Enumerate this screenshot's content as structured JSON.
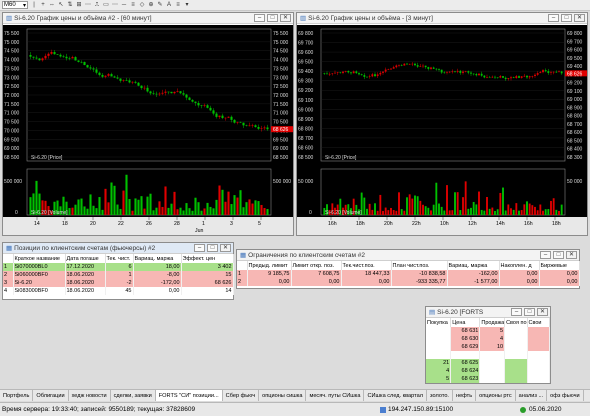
{
  "toolbar": {
    "timeframe": "M60",
    "buttons": [
      "|",
      "+",
      "⇔",
      "↖",
      "⇅",
      "⊞",
      "⋯",
      "⎍",
      "▭",
      "⋯",
      "─",
      "≡",
      "◇",
      "⊕",
      "✎",
      "A",
      "≡",
      "▾"
    ]
  },
  "chart1": {
    "title": "Si-6.20 График цены и объёма #2 - [60 минут]",
    "price_ticks": [
      "75 500",
      "75 000",
      "74 500",
      "74 000",
      "73 500",
      "73 000",
      "72 500",
      "72 000",
      "71 500",
      "71 000",
      "70 500",
      "70 000",
      "69 500",
      "69 000",
      "68 500"
    ],
    "right_ticks": [
      "75 500",
      "75 000",
      "74 500",
      "74 000",
      "73 500",
      "73 000",
      "72 500",
      "72 000",
      "71 500",
      "71 000",
      "70 500",
      "70 000",
      "69 500",
      "69 000",
      "68 500"
    ],
    "price_label": "Si-6.20 [Price]",
    "volume_label": "Si-6.20 [Volume]",
    "volume_ticks": [
      "500 000",
      "0"
    ],
    "x_labels": [
      "14",
      "18",
      "20",
      "22",
      "26",
      "28",
      "1",
      "3",
      "5"
    ],
    "x_sub": "Jun",
    "last_price": "68 626"
  },
  "chart2": {
    "title": "Si-6.20 График цены и объёма - [3 минут]",
    "price_ticks": [
      "69 800",
      "69 700",
      "69 600",
      "69 500",
      "69 400",
      "69 300",
      "69 200",
      "69 100",
      "69 000",
      "68 900",
      "68 800",
      "68 700",
      "68 600",
      "68 500"
    ],
    "right_ticks": [
      "69 800",
      "69 700",
      "69 600",
      "69 500",
      "69 400",
      "69 300",
      "69 200",
      "69 100",
      "69 000",
      "68 900",
      "68 800",
      "68 700",
      "68 600",
      "68 500",
      "68 400",
      "68 300"
    ],
    "price_label": "Si-6.20 [Price]",
    "volume_label": "Si-6.20 [Volume]",
    "volume_ticks": [
      "50 000",
      "0"
    ],
    "x_labels": [
      "16h",
      "18h",
      "20h",
      "22h",
      "10h",
      "12h",
      "14h",
      "16h",
      "18h"
    ],
    "last_price": "68 626"
  },
  "positions": {
    "title": "Позиции по клиентским счетам (фьючерсы) #2",
    "columns": [
      "",
      "Краткое название",
      "Дата погаше",
      "Тек. чист.",
      "Вариац. маржа",
      "Эффект. цен"
    ],
    "rows": [
      {
        "n": "1",
        "name": "Si070000BL0",
        "date": "17.12.2020",
        "net": "6",
        "vm": "18,00",
        "eff": "3 402",
        "style": "green"
      },
      {
        "n": "2",
        "name": "Si060000BF0",
        "date": "18.06.2020",
        "net": "1",
        "vm": "-8,00",
        "eff": "15",
        "style": "red"
      },
      {
        "n": "3",
        "name": "Si-6.20",
        "date": "18.06.2020",
        "net": "-2",
        "vm": "-172,00",
        "eff": "68 626",
        "style": "red"
      },
      {
        "n": "4",
        "name": "Si083000BF0",
        "date": "18.06.2020",
        "net": "45",
        "vm": "0,00",
        "eff": "14",
        "style": "white"
      }
    ]
  },
  "limits": {
    "title": "Ограничения по клиентским счетам #2",
    "columns": [
      "",
      "Предыд. лимит",
      "Лимит откр. поз.",
      "Тек.чист.поз.",
      "План чист.поз.",
      "Вариац. маржа",
      "Накоплен. д",
      "Биржевые"
    ],
    "rows": [
      {
        "n": "1",
        "c1": "9 185,75",
        "c2": "7 608,75",
        "c3": "18 447,33",
        "c4": "-10 838,58",
        "c5": "-162,00",
        "c6": "0,00",
        "c7": "0,00"
      },
      {
        "n": "2",
        "c1": "0,00",
        "c2": "0,00",
        "c3": "0,00",
        "c4": "-933 335,77",
        "c5": "-1 577,00",
        "c6": "0,00",
        "c7": "0,00"
      }
    ]
  },
  "orderbook": {
    "title": "Si-6.20 [FORTS",
    "columns": [
      "Покупка",
      "Цена",
      "Продажа",
      "Своя по",
      "Свои"
    ],
    "rows": [
      {
        "buy": "",
        "price": "68 631",
        "sell": "5",
        "type": "ask"
      },
      {
        "buy": "",
        "price": "68 630",
        "sell": "4",
        "type": "ask"
      },
      {
        "buy": "",
        "price": "68 629",
        "sell": "10",
        "type": "ask"
      },
      {
        "buy": "",
        "price": "",
        "sell": "",
        "type": "gap"
      },
      {
        "buy": "21",
        "price": "68 625",
        "sell": "",
        "type": "bid"
      },
      {
        "buy": "4",
        "price": "68 624",
        "sell": "",
        "type": "bid"
      },
      {
        "buy": "5",
        "price": "68 623",
        "sell": "",
        "type": "bid"
      }
    ]
  },
  "taskbar": [
    "Портфель",
    "Облигации",
    "хедж новости",
    "сделки, заявки",
    "FORTS \"СИ\" позиции...",
    "Сбер фьюч",
    "опционы сишка",
    "месяч. путы СИшка",
    "СИшка след. квартал",
    "золото.",
    "нефть",
    "опционы ртс",
    "анализ ...",
    "офз фьючи"
  ],
  "status": {
    "left": "Время сервера: 19:33:40; записей: 9550189; текущая: 37828609",
    "ip": "194.247.150.89:15100",
    "date": "05.06.2020"
  },
  "colors": {
    "bull": "#00c000",
    "bear": "#e00000",
    "green_row": "#a8e08a",
    "red_row": "#f7b7b4"
  }
}
